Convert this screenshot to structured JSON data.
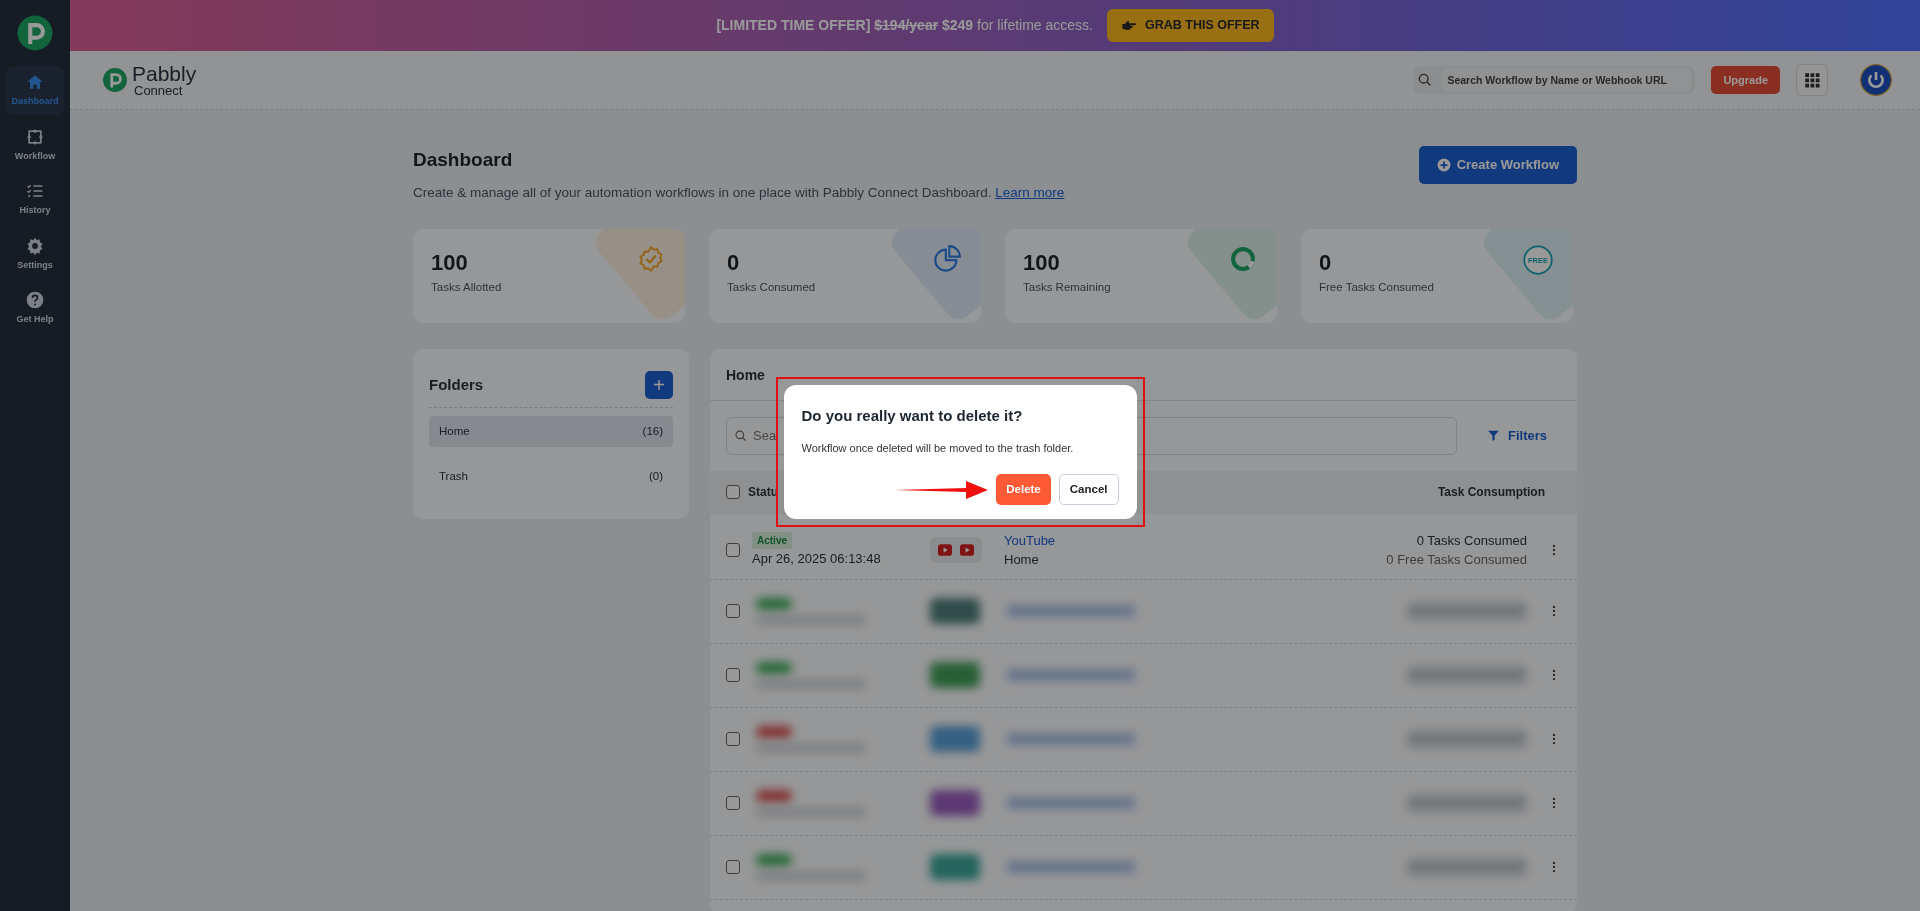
{
  "banner": {
    "parts": [
      {
        "text": "[LIMITED TIME OFFER]",
        "kind": "bold"
      },
      {
        "text": "$194/year",
        "kind": "strike"
      },
      {
        "text": "$249",
        "kind": "bold"
      },
      {
        "text": "for lifetime access.",
        "kind": "plain"
      }
    ],
    "button": "GRAB THIS OFFER"
  },
  "sidebar": {
    "items": [
      {
        "label": "Dashboard",
        "kind": "home",
        "selected": true
      },
      {
        "label": "Workflow",
        "kind": "workflow",
        "selected": false
      },
      {
        "label": "History",
        "kind": "history",
        "selected": false
      },
      {
        "label": "Settings",
        "kind": "settings",
        "selected": false
      },
      {
        "label": "Get Help",
        "kind": "help",
        "selected": false
      }
    ]
  },
  "header": {
    "logo": {
      "name": "Pabbly",
      "sub": "Connect"
    },
    "search": {
      "placeholder": "Search Workflow by Name or Webhook URL"
    },
    "upgrade": "Upgrade"
  },
  "page": {
    "title": "Dashboard",
    "subtitle": "Create & manage all of your automation workflows in one place with Pabbly Connect Dashboard.",
    "link": "Learn more",
    "create_button": "Create Workflow"
  },
  "stats": [
    {
      "value": "100",
      "label": "Tasks Allotted",
      "kind": "badge"
    },
    {
      "value": "0",
      "label": "Tasks Consumed",
      "kind": "pie"
    },
    {
      "value": "100",
      "label": "Tasks Remaining",
      "kind": "donut"
    },
    {
      "value": "0",
      "label": "Free Tasks Consumed",
      "kind": "free",
      "icon_text": "FREE"
    }
  ],
  "folders": {
    "title": "Folders",
    "add": "+",
    "items": [
      {
        "name": "Home",
        "count": "(16)",
        "selected": true
      },
      {
        "name": "Trash",
        "count": "(0)",
        "selected": false
      }
    ]
  },
  "workflows": {
    "title": "Home",
    "search": {
      "placeholder": "Sea"
    },
    "filters": "Filters",
    "select_all": {
      "checked": false
    },
    "columns": [
      "Statu",
      "Task Consumption"
    ],
    "rows": [
      {
        "kind": "workflow",
        "status": "Active",
        "date": "Apr 26, 2025 06:13:48",
        "name": "YouTube",
        "folder": "Home",
        "tasks": "0 Tasks Consumed",
        "free_tasks": "0 Free Tasks Consumed",
        "checked": false
      },
      {
        "kind": "blurred",
        "checked": false
      },
      {
        "kind": "blurred",
        "checked": false
      },
      {
        "kind": "blurred",
        "checked": false
      },
      {
        "kind": "blurred",
        "checked": false
      },
      {
        "kind": "blurred",
        "checked": false
      }
    ]
  },
  "dialog": {
    "title": "Do you really want to delete it?",
    "message": "Workflow once deleted will be moved to the trash folder.",
    "confirm": "Delete",
    "cancel": "Cancel"
  },
  "annotation": {
    "framed": true,
    "arrow": true
  }
}
